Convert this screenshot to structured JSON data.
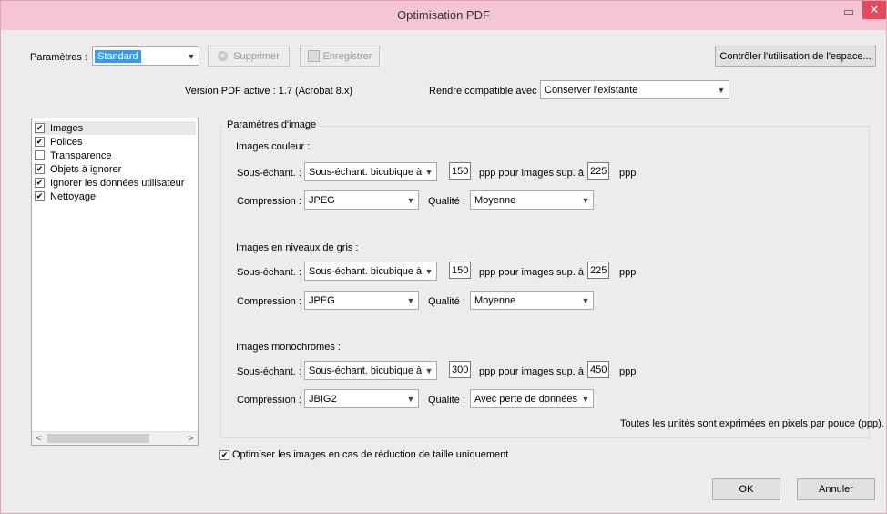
{
  "window": {
    "title": "Optimisation PDF",
    "min_glyph": "▭",
    "close_glyph": "✕"
  },
  "toolbar": {
    "params_label": "Paramètres :",
    "params_value": "Standard",
    "delete_label": "Supprimer",
    "save_label": "Enregistrer",
    "audit_label": "Contrôler l'utilisation de l'espace..."
  },
  "version": {
    "text": "Version PDF active : 1.7 (Acrobat 8.x)",
    "compat_label": "Rendre compatible avec :",
    "compat_value": "Conserver l'existante"
  },
  "sidebar": {
    "items": [
      {
        "label": "Images",
        "checked": true
      },
      {
        "label": "Polices",
        "checked": true
      },
      {
        "label": "Transparence",
        "checked": false
      },
      {
        "label": "Objets à ignorer",
        "checked": true
      },
      {
        "label": "Ignorer les données utilisateur",
        "checked": true
      },
      {
        "label": "Nettoyage",
        "checked": true
      }
    ],
    "scroll_left": "<",
    "scroll_right": ">"
  },
  "image_settings": {
    "group_title": "Paramètres d'image",
    "downsample_label": "Sous-échant. :",
    "compression_label": "Compression :",
    "quality_label": "Qualité :",
    "ppp_for_label": "ppp pour images sup. à",
    "ppp_label": "ppp",
    "color": {
      "title": "Images couleur :",
      "downsample": "Sous-échant. bicubique à",
      "res": "150",
      "above": "225",
      "compression": "JPEG",
      "quality": "Moyenne"
    },
    "gray": {
      "title": "Images en niveaux de gris :",
      "downsample": "Sous-échant. bicubique à",
      "res": "150",
      "above": "225",
      "compression": "JPEG",
      "quality": "Moyenne"
    },
    "mono": {
      "title": "Images monochromes :",
      "downsample": "Sous-échant. bicubique à",
      "res": "300",
      "above": "450",
      "compression": "JBIG2",
      "quality": "Avec perte de données"
    },
    "units_note": "Toutes les unités sont exprimées en pixels par pouce (ppp)."
  },
  "optimize_only": {
    "label": "Optimiser les images en cas de réduction de taille uniquement",
    "checked": true
  },
  "buttons": {
    "ok": "OK",
    "cancel": "Annuler"
  },
  "colors": {
    "titlebar": "#f4c5d5",
    "close": "#e6485e",
    "selection": "#3399ff"
  }
}
